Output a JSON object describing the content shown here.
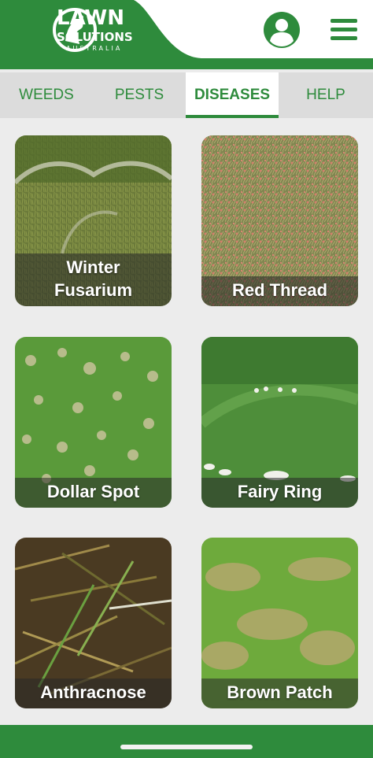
{
  "brand": {
    "name_line1": "LAWN",
    "name_line2": "SOLUTIONS",
    "name_line3": "AUSTRALIA",
    "primary_color": "#2e8b3c"
  },
  "header": {
    "profile_icon": "user-circle-icon",
    "menu_icon": "hamburger-menu-icon"
  },
  "tabs": [
    {
      "label": "WEEDS",
      "active": false
    },
    {
      "label": "PESTS",
      "active": false
    },
    {
      "label": "DISEASES",
      "active": true
    },
    {
      "label": "HELP",
      "active": false
    }
  ],
  "diseases": [
    {
      "label": "Winter\nFusarium"
    },
    {
      "label": "Red Thread"
    },
    {
      "label": "Dollar Spot"
    },
    {
      "label": "Fairy Ring"
    },
    {
      "label": "Anthracnose"
    },
    {
      "label": "Brown Patch"
    }
  ]
}
